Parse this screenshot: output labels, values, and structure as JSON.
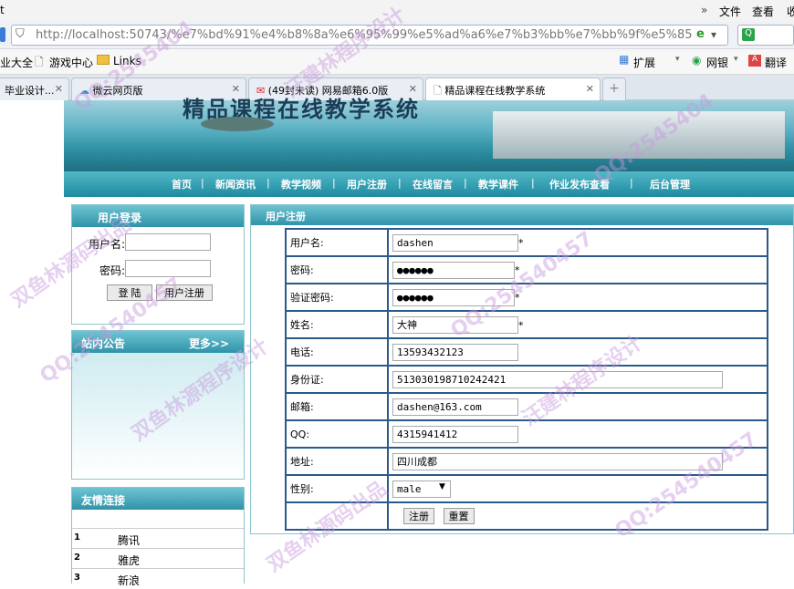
{
  "browser": {
    "menu": {
      "file": "文件",
      "view": "查看",
      "more": "»"
    },
    "url": "http://localhost:50743/%e7%bd%91%e4%b8%8a%e6%95%99%e5%ad%a6%e7%b3%bb%e7%bb%9f%e5%85%",
    "favorites": [
      "业大全",
      "游戏中心",
      "Links"
    ],
    "extensions": [
      "扩展",
      "网银",
      "翻译"
    ],
    "tabs": [
      "毕业设计...",
      "微云网页版",
      "(49封未读) 网易邮箱6.0版",
      "精品课程在线教学系统"
    ]
  },
  "site": {
    "title": "精品课程在线教学系统",
    "nav": [
      "首页",
      "新闻资讯",
      "教学视频",
      "用户注册",
      "在线留言",
      "教学课件",
      "作业发布查看",
      "后台管理"
    ]
  },
  "login": {
    "title": "用户登录",
    "user_label": "用户名:",
    "pwd_label": "密码:",
    "login_btn": "登 陆",
    "register_btn": "用户注册"
  },
  "notice": {
    "title": "站内公告",
    "more": "更多>>"
  },
  "links": {
    "title": "友情连接",
    "items": [
      {
        "n": "1",
        "name": "腾讯"
      },
      {
        "n": "2",
        "name": "雅虎"
      },
      {
        "n": "3",
        "name": "新浪"
      }
    ]
  },
  "register": {
    "title": "用户注册",
    "rows": [
      {
        "label": "用户名:",
        "value": "dashen",
        "required": "*"
      },
      {
        "label": "密码:",
        "value": "●●●●●●",
        "required": "*"
      },
      {
        "label": "验证密码:",
        "value": "●●●●●●",
        "required": "*"
      },
      {
        "label": "姓名:",
        "value": "大神",
        "required": "*"
      },
      {
        "label": "电话:",
        "value": "13593432123"
      },
      {
        "label": "身份证:",
        "value": "513030198710242421"
      },
      {
        "label": "邮箱:",
        "value": "dashen@163.com"
      },
      {
        "label": "QQ:",
        "value": "4315941412"
      },
      {
        "label": "地址:",
        "value": "四川成都"
      },
      {
        "label": "性别:",
        "value": "male"
      }
    ],
    "submit": "注册",
    "reset": "重置"
  },
  "watermarks": [
    "QQ:2545404",
    "双鱼林源码出品",
    "汪建林程序设计",
    "QQ:254540457",
    "双鱼林源程序设计",
    "QQ:254540457",
    "汪建林程序设计",
    "QQ:2545404",
    "双鱼林源码出品",
    "QQ:254540457"
  ],
  "colors": {
    "teal": "#2f93a8",
    "border": "#2b5a8a"
  }
}
